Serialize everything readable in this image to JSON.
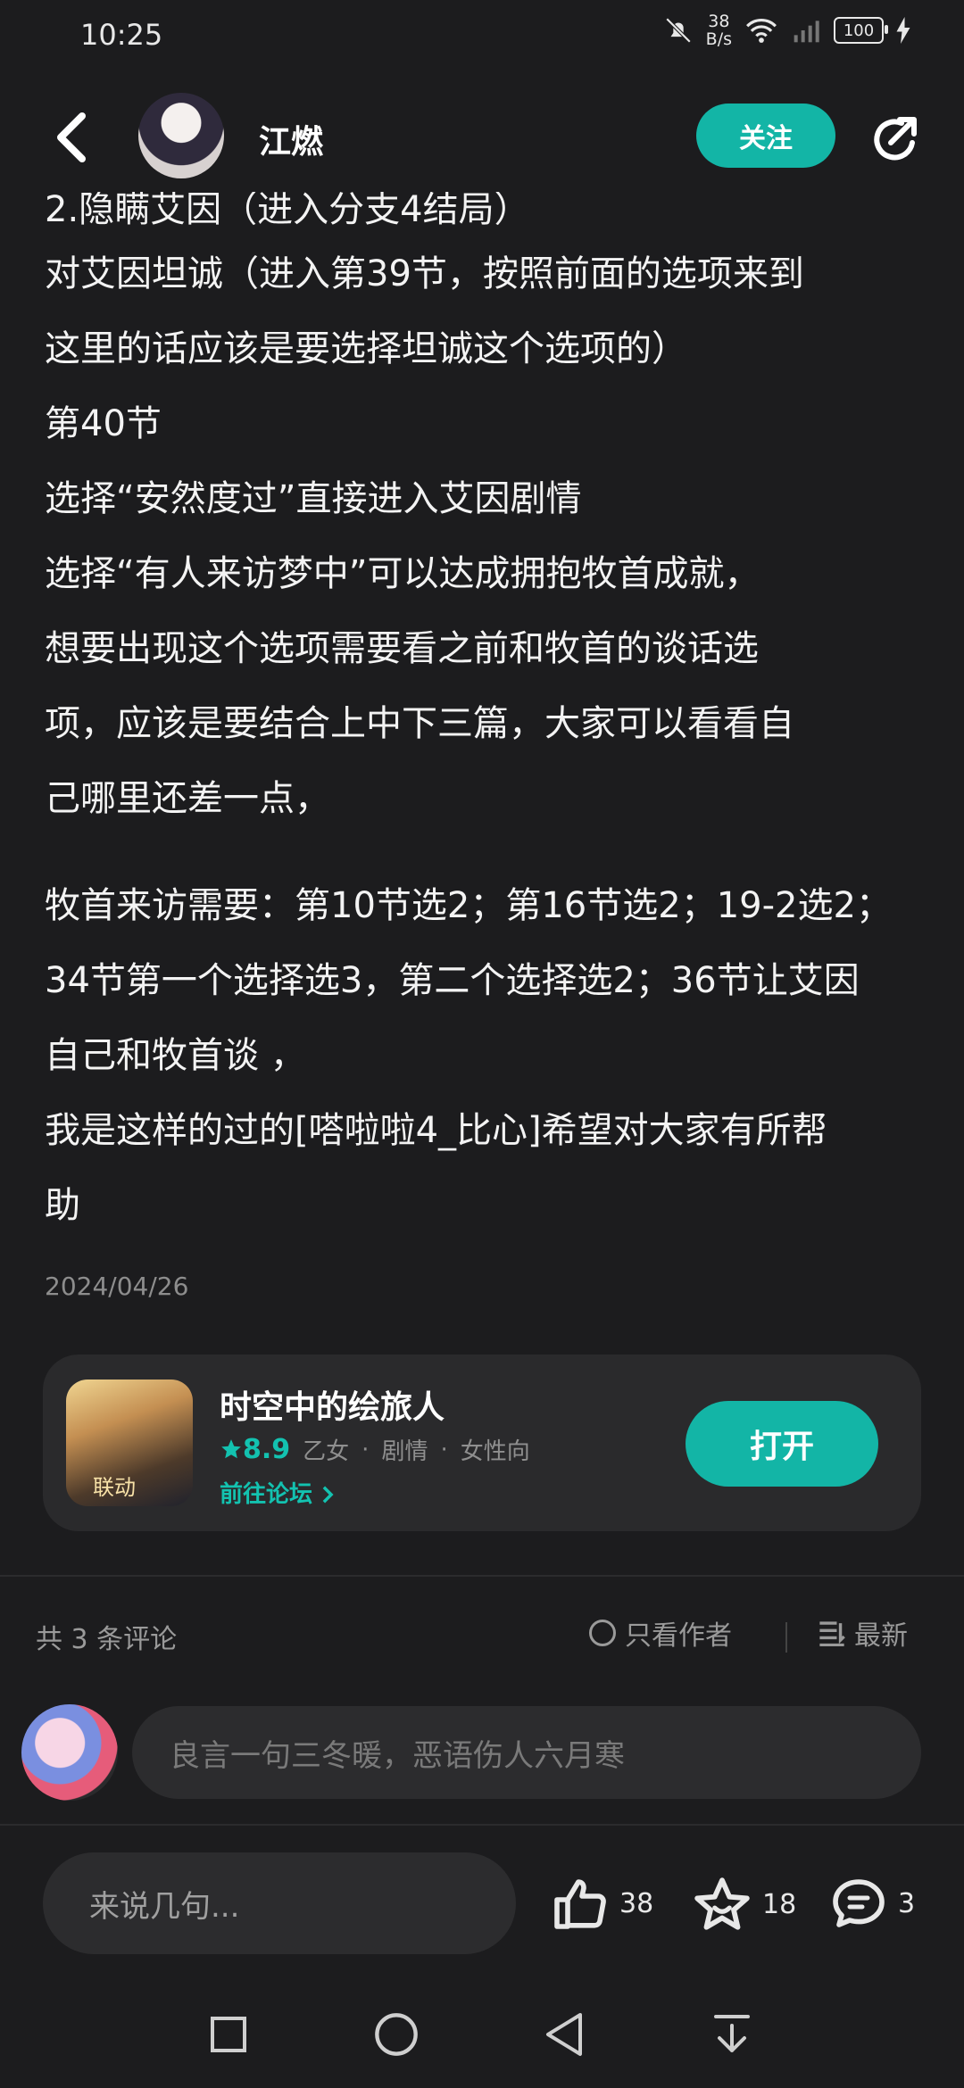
{
  "status_bar": {
    "time": "10:25",
    "net_speed_value": "38",
    "net_speed_unit": "B/s",
    "battery": "100"
  },
  "header": {
    "username": "江燃",
    "follow_label": "关注"
  },
  "article": {
    "lines": [
      "2.隐瞒艾因（进入分支4结局）",
      "  对艾因坦诚（进入第39节，按照前面的选项来到",
      "这里的话应该是要选择坦诚这个选项的）",
      "第40节",
      "选择“安然度过”直接进入艾因剧情",
      "选择“有人来访梦中”可以达成拥抱牧首成就，",
      "想要出现这个选项需要看之前和牧首的谈话选",
      "项，应该是要结合上中下三篇，大家可以看看自",
      "己哪里还差一点，",
      "牧首来访需要：第10节选2；第16节选2；19-2选2；",
      "34节第一个选择选3，第二个选择选2；36节让艾因",
      "自己和牧首谈 ，",
      "我是这样的过的[嗒啦啦4_比心]希望对大家有所帮",
      "助"
    ],
    "date": "2024/04/26"
  },
  "app_card": {
    "name": "时空中的绘旅人",
    "rating": "8.9",
    "tags": [
      "乙女",
      "剧情",
      "女性向"
    ],
    "separator": "·",
    "forum_link": "前往论坛",
    "open_label": "打开",
    "icon_badge": "联动"
  },
  "comments": {
    "count_label": "共 3 条评论",
    "author_only_label": "只看作者",
    "sort_label": "最新",
    "input_placeholder": "良言一句三冬暖，恶语伤人六月寒"
  },
  "bottom_bar": {
    "say_placeholder": "来说几句...",
    "likes": "38",
    "favorites": "18",
    "comments": "3"
  },
  "colors": {
    "accent": "#13b5a6",
    "background": "#1c1c1e",
    "card": "#2a2a2c"
  }
}
